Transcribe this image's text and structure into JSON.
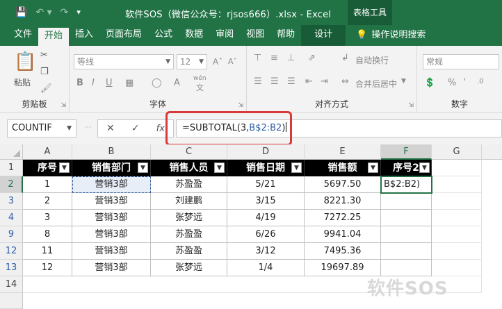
{
  "titlebar": {
    "title": "软件SOS（微信公众号：rjsos666）.xlsx  -  Excel",
    "context_tab_group": "表格工具"
  },
  "tabs": [
    "文件",
    "开始",
    "插入",
    "页面布局",
    "公式",
    "数据",
    "审阅",
    "视图",
    "帮助",
    "设计"
  ],
  "help_search": "操作说明搜索",
  "ribbon": {
    "clipboard_label": "剪贴板",
    "paste_label": "粘贴",
    "font_label": "字体",
    "font_name": "等线",
    "font_size": "12",
    "phonetic": "wén",
    "align_label": "对齐方式",
    "wrap_text": "自动换行",
    "merge_center": "合并后居中",
    "number_label": "数字",
    "number_format": "常规"
  },
  "formula_bar": {
    "name_box": "COUNTIF",
    "formula_prefix": "=SUBTOTAL(3,",
    "formula_ref": "B$2:B2",
    "formula_suffix": ")"
  },
  "sheet": {
    "columns": [
      "A",
      "B",
      "C",
      "D",
      "E",
      "F",
      "G"
    ],
    "header_row_number": "1",
    "headers": [
      "序号",
      "销售部门",
      "销售人员",
      "销售日期",
      "销售额",
      "序号2"
    ],
    "rows": [
      {
        "row": "2",
        "cells": [
          "1",
          "营销3部",
          "苏盈盈",
          "5/21",
          "5697.50",
          "B$2:B2)"
        ]
      },
      {
        "row": "3",
        "cells": [
          "2",
          "营销3部",
          "刘建鹏",
          "3/15",
          "8221.30",
          ""
        ]
      },
      {
        "row": "4",
        "cells": [
          "3",
          "营销3部",
          "张梦远",
          "4/19",
          "7272.25",
          ""
        ]
      },
      {
        "row": "9",
        "cells": [
          "8",
          "营销3部",
          "苏盈盈",
          "6/26",
          "9941.04",
          ""
        ]
      },
      {
        "row": "12",
        "cells": [
          "11",
          "营销3部",
          "苏盈盈",
          "3/12",
          "7495.36",
          ""
        ]
      },
      {
        "row": "13",
        "cells": [
          "12",
          "营销3部",
          "张梦远",
          "1/4",
          "19697.89",
          ""
        ]
      }
    ],
    "empty_row": "14"
  },
  "watermark": "软件SOS",
  "colors": {
    "excel_green": "#217346",
    "highlight_red": "#d83a3a",
    "ref_blue": "#2f5ea8"
  }
}
